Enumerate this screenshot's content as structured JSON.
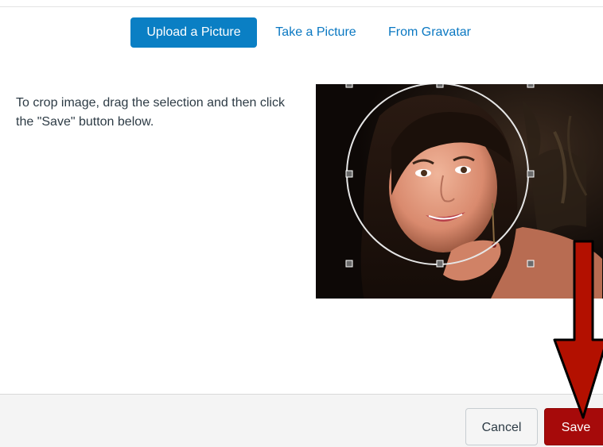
{
  "tabs": [
    {
      "label": "Upload a Picture",
      "active": true
    },
    {
      "label": "Take a Picture",
      "active": false
    },
    {
      "label": "From Gravatar",
      "active": false
    }
  ],
  "instructions": "To crop image, drag the selection and then click the \"Save\" button below.",
  "footer": {
    "cancel_label": "Cancel",
    "save_label": "Save"
  },
  "colors": {
    "accent": "#0a7fc4",
    "save_button": "#a60a0a",
    "annotation_arrow": "#b31000"
  },
  "icons": {
    "crop_selection": "circle-crop-selection",
    "annotation": "red-down-arrow"
  }
}
